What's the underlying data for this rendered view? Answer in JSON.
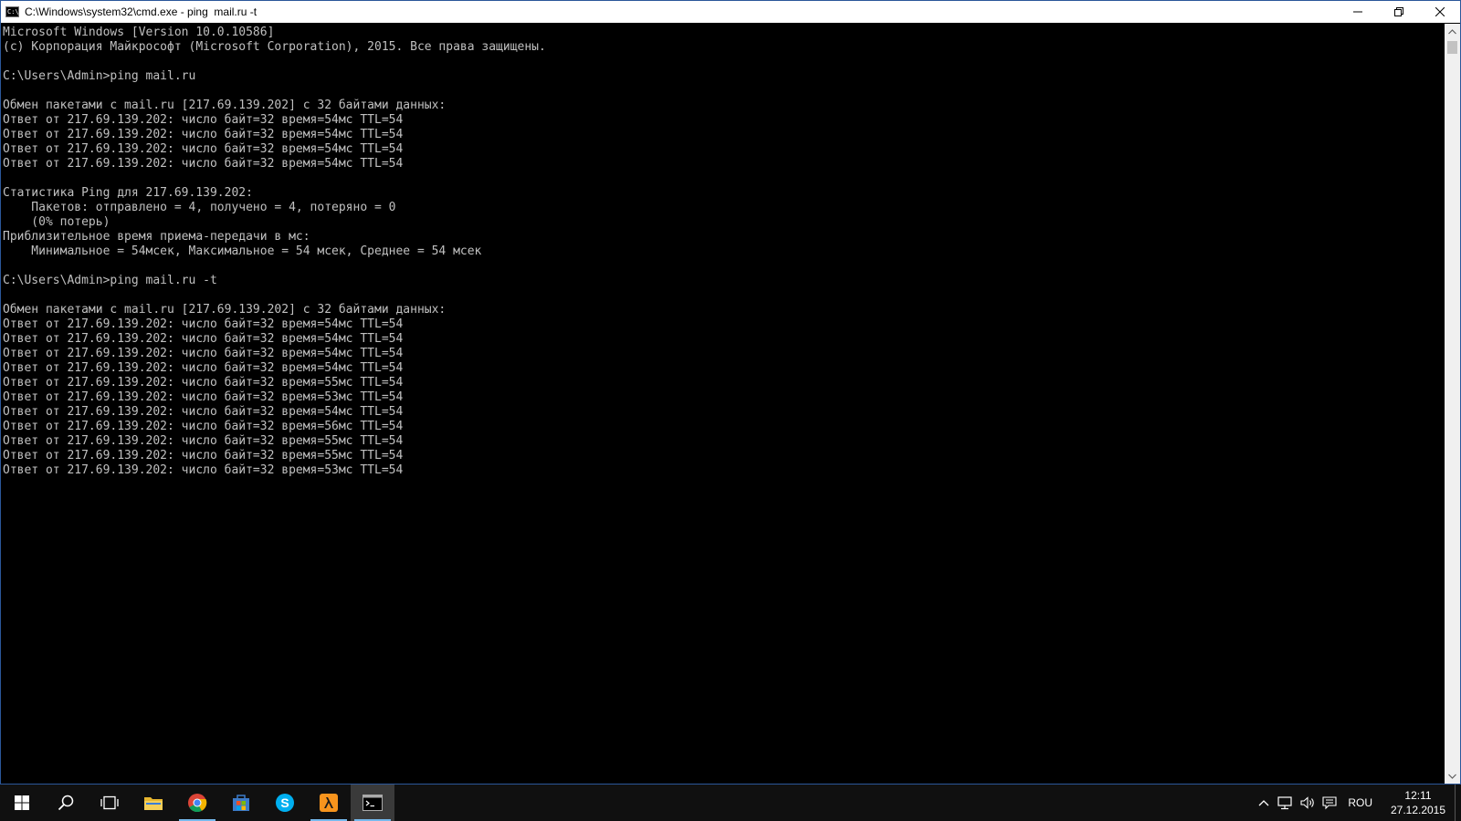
{
  "window": {
    "title": "C:\\Windows\\system32\\cmd.exe - ping  mail.ru -t"
  },
  "console": {
    "lines": [
      "Microsoft Windows [Version 10.0.10586]",
      "(c) Корпорация Майкрософт (Microsoft Corporation), 2015. Все права защищены.",
      "",
      "C:\\Users\\Admin>ping mail.ru",
      "",
      "Обмен пакетами с mail.ru [217.69.139.202] с 32 байтами данных:",
      "Ответ от 217.69.139.202: число байт=32 время=54мс TTL=54",
      "Ответ от 217.69.139.202: число байт=32 время=54мс TTL=54",
      "Ответ от 217.69.139.202: число байт=32 время=54мс TTL=54",
      "Ответ от 217.69.139.202: число байт=32 время=54мс TTL=54",
      "",
      "Статистика Ping для 217.69.139.202:",
      "    Пакетов: отправлено = 4, получено = 4, потеряно = 0",
      "    (0% потерь)",
      "Приблизительное время приема-передачи в мс:",
      "    Минимальное = 54мсек, Максимальное = 54 мсек, Среднее = 54 мсек",
      "",
      "C:\\Users\\Admin>ping mail.ru -t",
      "",
      "Обмен пакетами с mail.ru [217.69.139.202] с 32 байтами данных:",
      "Ответ от 217.69.139.202: число байт=32 время=54мс TTL=54",
      "Ответ от 217.69.139.202: число байт=32 время=54мс TTL=54",
      "Ответ от 217.69.139.202: число байт=32 время=54мс TTL=54",
      "Ответ от 217.69.139.202: число байт=32 время=54мс TTL=54",
      "Ответ от 217.69.139.202: число байт=32 время=55мс TTL=54",
      "Ответ от 217.69.139.202: число байт=32 время=53мс TTL=54",
      "Ответ от 217.69.139.202: число байт=32 время=54мс TTL=54",
      "Ответ от 217.69.139.202: число байт=32 время=56мс TTL=54",
      "Ответ от 217.69.139.202: число байт=32 время=55мс TTL=54",
      "Ответ от 217.69.139.202: число байт=32 время=55мс TTL=54",
      "Ответ от 217.69.139.202: число байт=32 время=53мс TTL=54"
    ]
  },
  "taskbar": {
    "items": [
      {
        "name": "start-button",
        "icon": "windows-logo-icon"
      },
      {
        "name": "search-button",
        "icon": "search-icon"
      },
      {
        "name": "task-view-button",
        "icon": "task-view-icon"
      },
      {
        "name": "file-explorer-button",
        "icon": "folder-icon"
      },
      {
        "name": "chrome-button",
        "icon": "chrome-icon"
      },
      {
        "name": "store-button",
        "icon": "store-icon"
      },
      {
        "name": "skype-button",
        "icon": "skype-icon"
      },
      {
        "name": "half-life-button",
        "icon": "lambda-icon"
      },
      {
        "name": "cmd-button",
        "icon": "cmd-icon"
      }
    ],
    "tray": {
      "language": "ROU",
      "time": "12:11",
      "date": "27.12.2015"
    }
  },
  "colors": {
    "console_bg": "#000000",
    "console_fg": "#c0c0c0",
    "taskbar_bg": "#101010",
    "accent": "#76b9ed"
  }
}
